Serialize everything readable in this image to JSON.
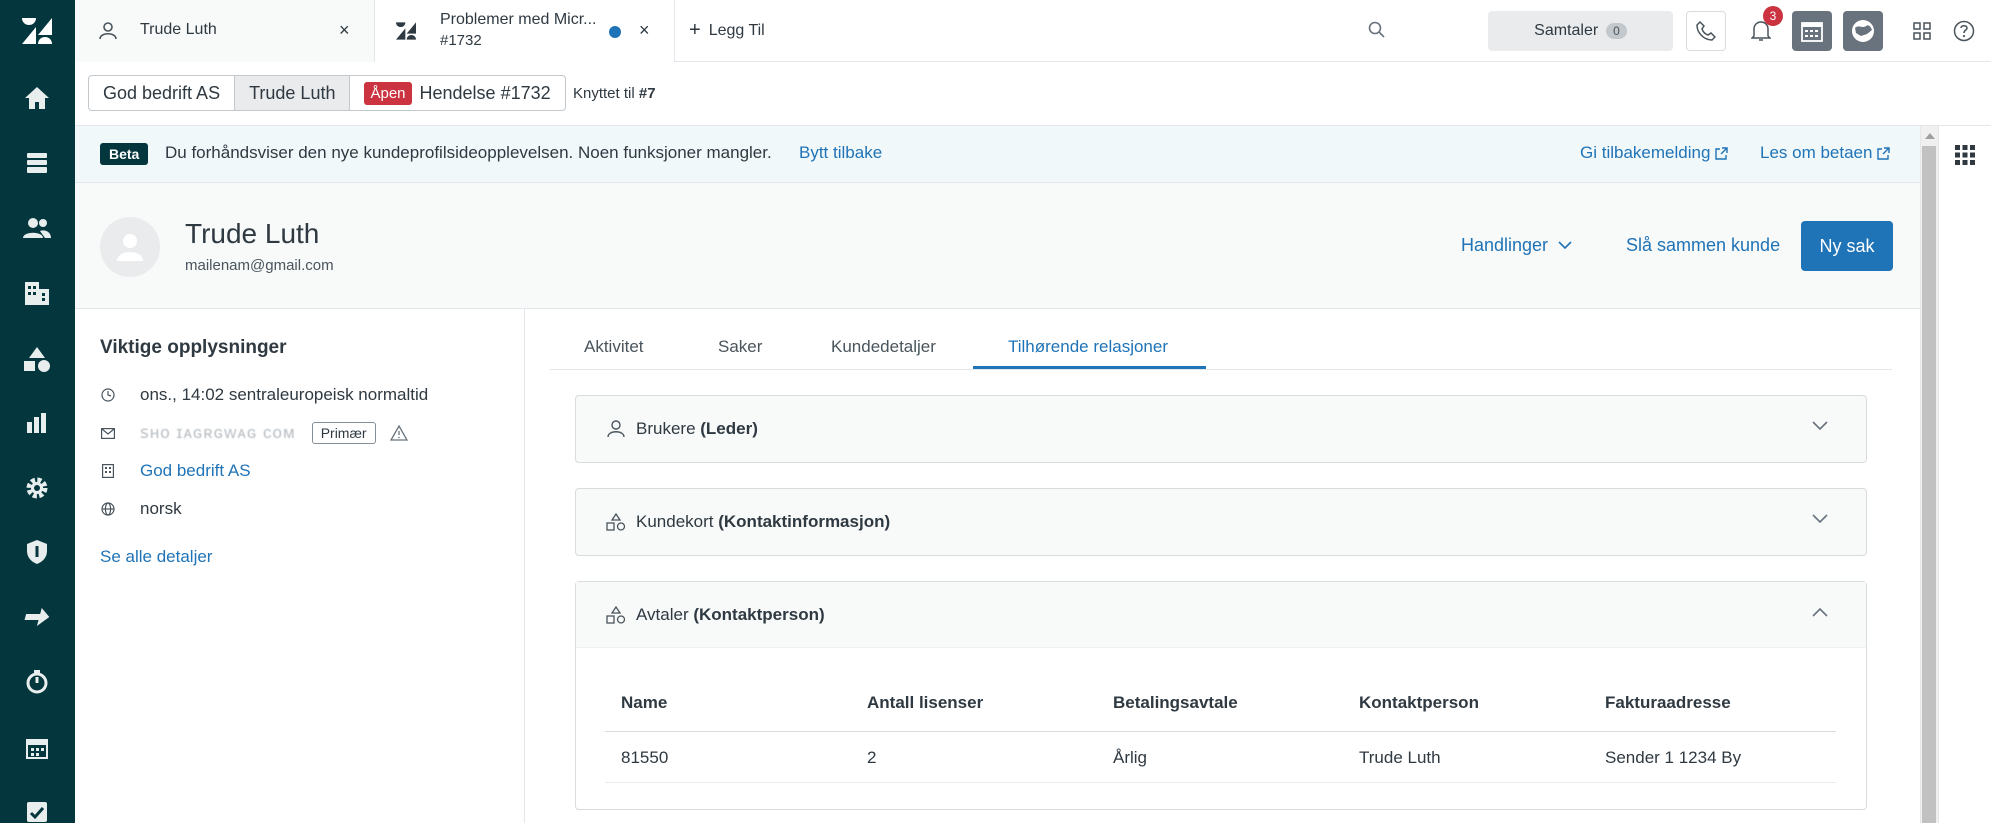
{
  "tabs": [
    {
      "title": "Trude Luth",
      "close": "×"
    },
    {
      "title": "Problemer med Micr...",
      "subtitle": "#1732",
      "close": "×"
    }
  ],
  "add_tab_label": "Legg Til",
  "conversations": {
    "label": "Samtaler",
    "count": "0"
  },
  "notifications_count": "3",
  "breadcrumb": {
    "org": "God bedrift AS",
    "user": "Trude Luth",
    "status": "Åpen",
    "ticket": "Hendelse #1732",
    "linked_prefix": "Knyttet til",
    "linked_id": "#7"
  },
  "beta": {
    "tag": "Beta",
    "message": "Du forhåndsviser den nye kundeprofilsideopplevelsen. Noen funksjoner mangler.",
    "switch_back": "Bytt tilbake",
    "feedback": "Gi tilbakemelding",
    "learn": "Les om betaen"
  },
  "profile": {
    "name": "Trude Luth",
    "email": "mailenam@gmail.com",
    "actions": "Handlinger",
    "merge": "Slå sammen kunde",
    "new_case": "Ny sak"
  },
  "info": {
    "heading": "Viktige opplysninger",
    "time": "ons., 14:02 sentraleuropeisk normaltid",
    "email_obscured": "ꜱʜᴏ ɪᴀɢʀɢᴡᴀɢ ᴄᴏᴍ",
    "primary": "Primær",
    "org": "God bedrift AS",
    "language": "norsk",
    "see_all": "Se alle detaljer"
  },
  "main_tabs": [
    "Aktivitet",
    "Saker",
    "Kundedetaljer",
    "Tilhørende relasjoner"
  ],
  "accordions": [
    {
      "label": "Brukere",
      "role": "(Leder)"
    },
    {
      "label": "Kundekort",
      "role": "(Kontaktinformasjon)"
    },
    {
      "label": "Avtaler",
      "role": "(Kontaktperson)"
    }
  ],
  "table": {
    "headers": [
      "Name",
      "Antall lisenser",
      "Betalingsavtale",
      "Kontaktperson",
      "Fakturaadresse"
    ],
    "rows": [
      [
        "81550",
        "2",
        "Årlig",
        "Trude Luth",
        "Sender 1 1234 By"
      ]
    ]
  },
  "colors": {
    "nav": "#03363d",
    "accent": "#1f73b7",
    "open": "#cc3340"
  }
}
